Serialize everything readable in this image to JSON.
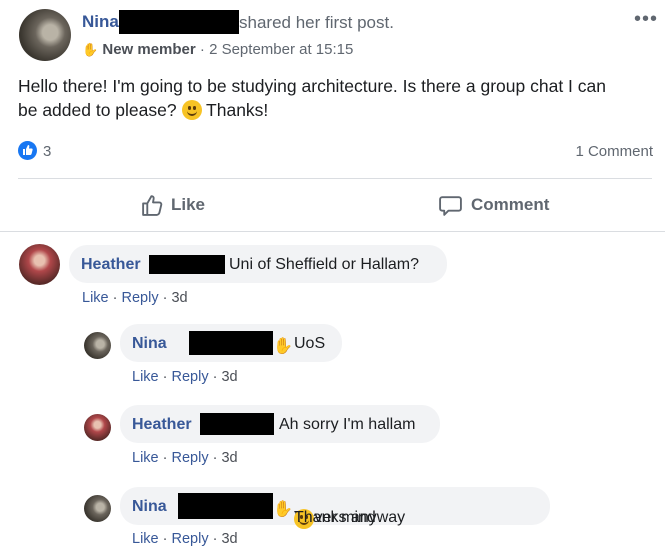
{
  "post": {
    "author": "Nina",
    "shared_text": "shared her first post.",
    "badge": "New member",
    "separator": "·",
    "date": "2 September at 15:15",
    "body_line1": "Hello there! I'm going to be studying architecture. Is there a group chat I can",
    "body_line2": "be added to please?",
    "body_after_emoji": "Thanks!",
    "like_count": "3",
    "comment_count": "1 Comment",
    "like_button": "Like",
    "comment_button": "Comment",
    "more_icon": "more-options-icon"
  },
  "comments": [
    {
      "author": "Heather",
      "text": "Uni of Sheffield or Hallam?",
      "like": "Like",
      "reply": "Reply",
      "time": "3d"
    },
    {
      "author": "Nina",
      "text": "UoS",
      "like": "Like",
      "reply": "Reply",
      "time": "3d"
    },
    {
      "author": "Heather",
      "text": "Ah sorry I'm hallam",
      "like": "Like",
      "reply": "Reply",
      "time": "3d"
    },
    {
      "author": "Nina",
      "text": "Never mind",
      "text_after_emoji": "Thanks anyway",
      "like": "Like",
      "reply": "Reply",
      "time": "3d"
    }
  ],
  "colors": {
    "link": "#385898",
    "bubble": "#f2f3f5",
    "like_badge": "#1877f2"
  }
}
